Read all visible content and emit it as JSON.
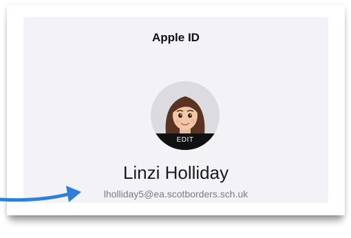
{
  "header": {
    "title": "Apple ID"
  },
  "profile": {
    "avatar_edit_label": "EDIT",
    "name": "Linzi Holliday",
    "email": "lholliday5@ea.scotborders.sch.uk"
  },
  "annotation": {
    "arrow_icon": "arrow-right-icon",
    "arrow_color": "#2f7fd6"
  },
  "colors": {
    "screen_background": "#f2f2f7",
    "avatar_background": "#dcdce0",
    "edit_band": "#111111"
  }
}
